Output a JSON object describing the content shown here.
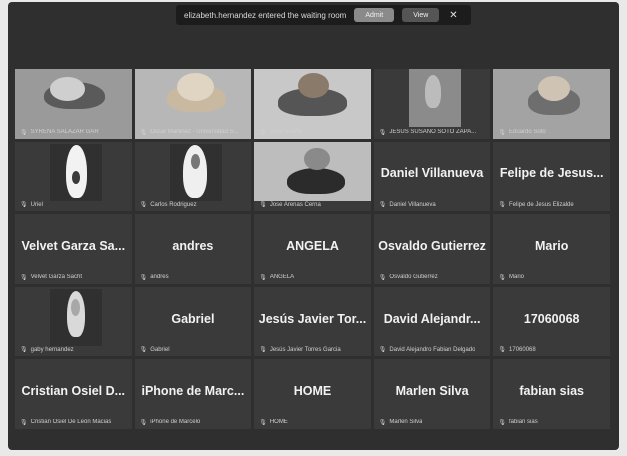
{
  "notification": {
    "text": "elizabeth.hernandez entered the waiting room",
    "admit_label": "Admit",
    "view_label": "View",
    "close_icon": "close-icon"
  },
  "participants": [
    {
      "display": "SYRENA SALAZAR GAR",
      "label": "SYRENA SALAZAR GAR",
      "video": true
    },
    {
      "display": "",
      "label": "Oscar Martinez - Universidad S...",
      "video": true
    },
    {
      "display": "",
      "label": "Jose Huerta",
      "video": true
    },
    {
      "display": "",
      "label": "JESUS SUSANO SOTO ZAPA...",
      "video": true
    },
    {
      "display": "",
      "label": "Eduardo Soto",
      "video": true
    },
    {
      "display": "",
      "label": "Uriel",
      "video": true
    },
    {
      "display": "",
      "label": "Carlos Rodriguez",
      "video": true
    },
    {
      "display": "",
      "label": "Jose Arenas Cerna",
      "video": true
    },
    {
      "display": "Daniel Villanueva",
      "label": "Daniel Villanueva",
      "video": false
    },
    {
      "display": "Felipe de Jesus...",
      "label": "Felipe de Jesus Elizalde",
      "video": false
    },
    {
      "display": "Velvet Garza Sa...",
      "label": "Velvet Garza Sacht",
      "video": false
    },
    {
      "display": "andres",
      "label": "andres",
      "video": false
    },
    {
      "display": "ANGELA",
      "label": "ANGELA",
      "video": false
    },
    {
      "display": "Osvaldo Gutierrez",
      "label": "Osvaldo Gutierrez",
      "video": false
    },
    {
      "display": "Mario",
      "label": "Mario",
      "video": false
    },
    {
      "display": "",
      "label": "gaby hernandez",
      "video": true
    },
    {
      "display": "Gabriel",
      "label": "Gabriel",
      "video": false
    },
    {
      "display": "Jesús Javier Tor...",
      "label": "Jesús Javier Torres Garcia",
      "video": false
    },
    {
      "display": "David Alejandr...",
      "label": "David Alejandro Fabian Delgado",
      "video": false
    },
    {
      "display": "17060068",
      "label": "17060068",
      "video": false
    },
    {
      "display": "Cristian Osiel D...",
      "label": "Cristian Osiel De León Macias",
      "video": false
    },
    {
      "display": "iPhone de Marc...",
      "label": "iPhone de Marcelo",
      "video": false
    },
    {
      "display": "HOME",
      "label": "HOME",
      "video": false
    },
    {
      "display": "Marlen Silva",
      "label": "Marlen Silva",
      "video": false
    },
    {
      "display": "fabian sias",
      "label": "fabian sias",
      "video": false
    }
  ],
  "icons": {
    "muted_mic": "muted-mic-icon"
  }
}
